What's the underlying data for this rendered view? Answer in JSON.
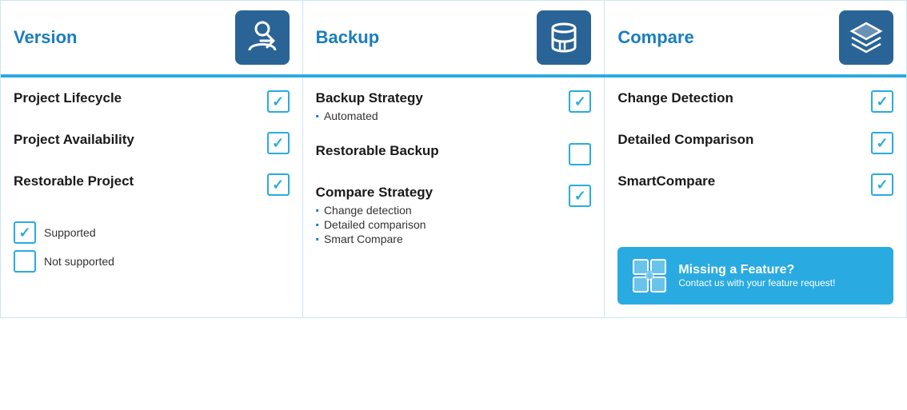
{
  "header": {
    "version_label": "Version",
    "backup_label": "Backup",
    "compare_label": "Compare"
  },
  "version_features": [
    {
      "title": "Project Lifecycle",
      "checked": true,
      "bullets": []
    },
    {
      "title": "Project Availability",
      "checked": true,
      "bullets": []
    },
    {
      "title": "Restorable Project",
      "checked": true,
      "bullets": []
    }
  ],
  "backup_features": [
    {
      "title": "Backup Strategy",
      "checked": true,
      "bullets": [
        "Automated"
      ]
    },
    {
      "title": "Restorable Backup",
      "checked": false,
      "bullets": []
    },
    {
      "title": "Compare Strategy",
      "checked": true,
      "bullets": [
        "Change detection",
        "Detailed comparison",
        "Smart Compare"
      ]
    }
  ],
  "compare_features": [
    {
      "title": "Change Detection",
      "checked": true,
      "bullets": []
    },
    {
      "title": "Detailed Comparison",
      "checked": true,
      "bullets": []
    },
    {
      "title": "SmartCompare",
      "checked": true,
      "bullets": []
    }
  ],
  "legend": {
    "supported": "Supported",
    "not_supported": "Not supported"
  },
  "missing_feature": {
    "title": "Missing a Feature?",
    "subtitle": "Contact us with your feature request!"
  }
}
